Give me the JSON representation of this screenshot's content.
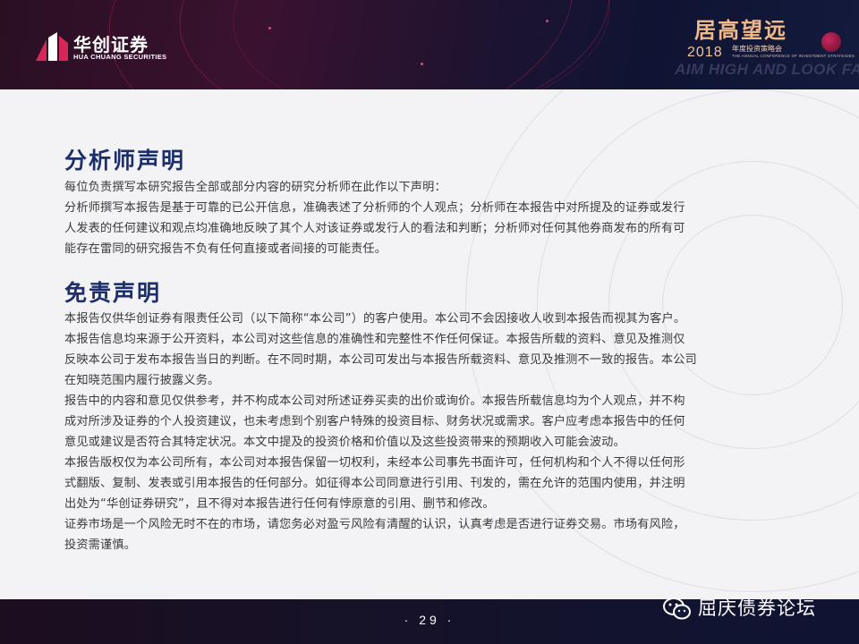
{
  "header": {
    "logo_cn": "华创证券",
    "logo_en": "HUA CHUANG SECURITIES",
    "brand_title": "居高望远",
    "brand_year": "2018",
    "brand_conference": "年度投资策略会",
    "brand_conference_en": "THE ANNUAL CONFERENCE OF INVESTMENT STRATEGIES",
    "brand_slogan": "AIM HIGH AND LOOK FAR",
    "accent_color": "#d6265a"
  },
  "analyst": {
    "title": "分析师声明",
    "lines": [
      "每位负责撰写本研究报告全部或部分内容的研究分析师在此作以下声明：",
      "分析师撰写本报告是基于可靠的已公开信息，准确表述了分析师的个人观点；分析师在本报告中对所提及的证券或发行",
      "人发表的任何建议和观点均准确地反映了其个人对该证券或发行人的看法和判断；分析师对任何其他券商发布的所有可",
      "能存在雷同的研究报告不负有任何直接或者间接的可能责任。"
    ]
  },
  "disclaimer": {
    "title": "免责声明",
    "lines": [
      "本报告仅供华创证券有限责任公司（以下简称“本公司”）的客户使用。本公司不会因接收人收到本报告而视其为客户。",
      "本报告信息均来源于公开资料，本公司对这些信息的准确性和完整性不作任何保证。本报告所载的资料、意见及推测仅",
      "反映本公司于发布本报告当日的判断。在不同时期，本公司可发出与本报告所载资料、意见及推测不一致的报告。本公司",
      "在知晓范围内履行披露义务。",
      "报告中的内容和意见仅供参考，并不构成本公司对所述证券买卖的出价或询价。本报告所载信息均为个人观点，并不构",
      "成对所涉及证券的个人投资建议，也未考虑到个别客户特殊的投资目标、财务状况或需求。客户应考虑本报告中的任何",
      "意见或建议是否符合其特定状况。本文中提及的投资价格和价值以及这些投资带来的预期收入可能会波动。",
      "本报告版权仅为本公司所有，本公司对本报告保留一切权利，未经本公司事先书面许可，任何机构和个人不得以任何形",
      "式翻版、复制、发表或引用本报告的任何部分。如征得本公司同意进行引用、刊发的，需在允许的范围内使用，并注明",
      "出处为“华创证券研究”，且不得对本报告进行任何有悖原意的引用、删节和修改。",
      "证券市场是一个风险无时不在的市场，请您务必对盈亏风险有清醒的认识，认真考虑是否进行证券交易。市场有风险，",
      "投资需谨慎。"
    ]
  },
  "footer": {
    "page_number": "· 29 ·",
    "watermark_icon": "wechat-icon",
    "watermark_text": "屈庆债券论坛"
  }
}
